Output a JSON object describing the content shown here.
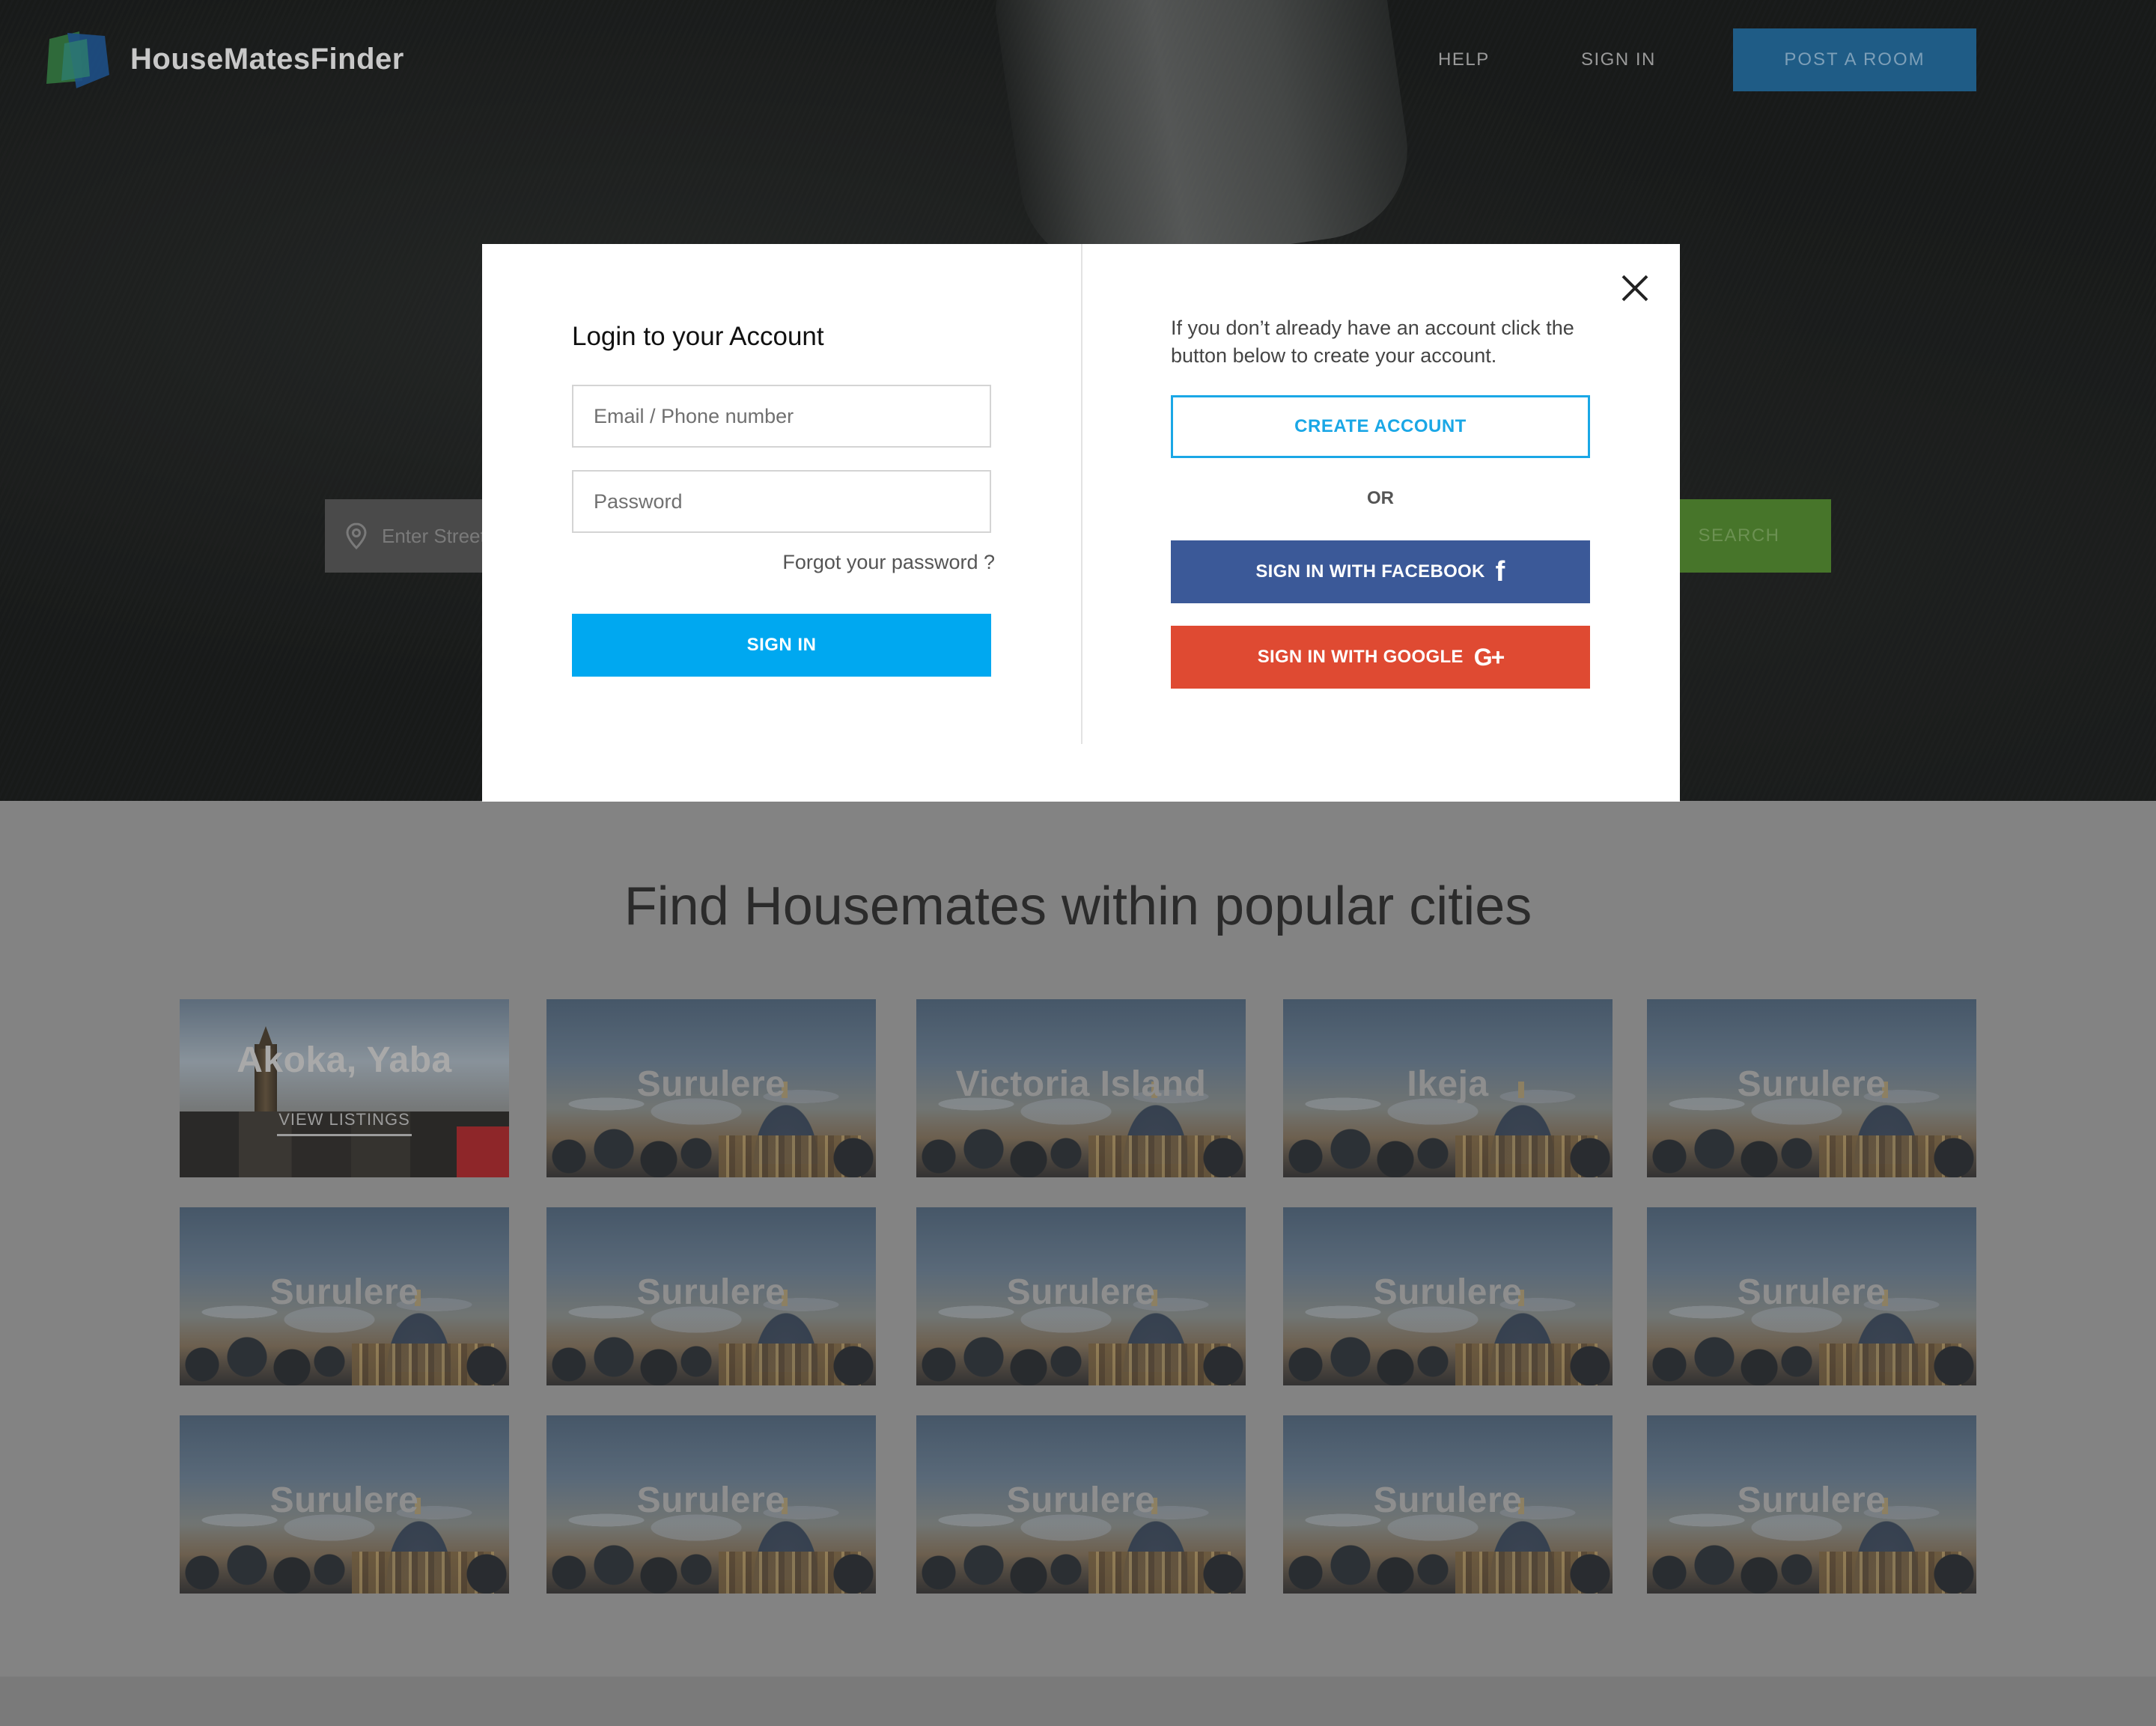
{
  "header": {
    "brand": "HouseMatesFinder",
    "nav": {
      "help": "HELP",
      "sign_in": "SIGN IN",
      "post_room": "POST A ROOM"
    }
  },
  "search": {
    "placeholder": "Enter Street",
    "button": "SEARCH"
  },
  "section": {
    "title": "Find Housemates within popular cities",
    "view_listings": "VIEW LISTINGS",
    "cities": [
      [
        "Akoka, Yaba",
        "Surulere",
        "Victoria Island",
        "Ikeja",
        "Surulere"
      ],
      [
        "Surulere",
        "Surulere",
        "Surulere",
        "Surulere",
        "Surulere"
      ],
      [
        "Surulere",
        "Surulere",
        "Surulere",
        "Surulere",
        "Surulere"
      ]
    ]
  },
  "modal": {
    "title": "Login to your Account",
    "email_placeholder": "Email / Phone number",
    "password_placeholder": "Password",
    "forgot": "Forgot your password ?",
    "sign_in": "SIGN IN",
    "info": "If you don’t already have an account click the button below to create your account.",
    "create_account": "CREATE ACCOUNT",
    "or": "OR",
    "facebook": "SIGN IN WITH FACEBOOK",
    "google": "SIGN IN WITH GOOGLE",
    "icons": {
      "close": "close-icon",
      "facebook": "facebook-icon",
      "google": "google-plus-icon",
      "location": "location-pin-icon"
    }
  },
  "colors": {
    "accent_blue": "#00a8f0",
    "create_border": "#1aa7e6",
    "facebook": "#3b5998",
    "google": "#df4a32",
    "post_room_button": "#1f5c86",
    "search_button": "#47752a"
  }
}
